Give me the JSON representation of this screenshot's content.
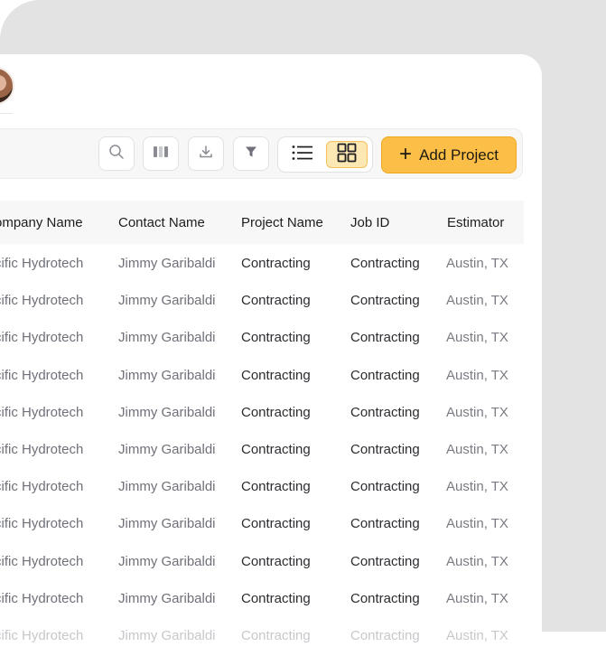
{
  "table": {
    "headers": [
      "ompany Name",
      "Contact Name",
      "Project Name",
      "Job ID",
      "Estimator"
    ],
    "rows": [
      [
        "cific Hydrotech",
        "Jimmy Garibaldi",
        "Contracting",
        "Contracting",
        "Austin, TX"
      ],
      [
        "cific Hydrotech",
        "Jimmy Garibaldi",
        "Contracting",
        "Contracting",
        "Austin, TX"
      ],
      [
        "cific Hydrotech",
        "Jimmy Garibaldi",
        "Contracting",
        "Contracting",
        "Austin, TX"
      ],
      [
        "cific Hydrotech",
        "Jimmy Garibaldi",
        "Contracting",
        "Contracting",
        "Austin, TX"
      ],
      [
        "cific Hydrotech",
        "Jimmy Garibaldi",
        "Contracting",
        "Contracting",
        "Austin, TX"
      ],
      [
        "cific Hydrotech",
        "Jimmy Garibaldi",
        "Contracting",
        "Contracting",
        "Austin, TX"
      ],
      [
        "cific Hydrotech",
        "Jimmy Garibaldi",
        "Contracting",
        "Contracting",
        "Austin, TX"
      ],
      [
        "cific Hydrotech",
        "Jimmy Garibaldi",
        "Contracting",
        "Contracting",
        "Austin, TX"
      ],
      [
        "cific Hydrotech",
        "Jimmy Garibaldi",
        "Contracting",
        "Contracting",
        "Austin, TX"
      ],
      [
        "cific Hydrotech",
        "Jimmy Garibaldi",
        "Contracting",
        "Contracting",
        "Austin, TX"
      ],
      [
        "cific Hydrotech",
        "Jimmy Garibaldi",
        "Contracting",
        "Contracting",
        "Austin, TX"
      ]
    ]
  },
  "toolbar": {
    "add_label": "Add Project",
    "icons": [
      "search-icon",
      "columns-icon",
      "download-icon",
      "filter-icon",
      "list-view-icon",
      "grid-view-icon"
    ],
    "active_view": "grid"
  },
  "colors": {
    "accent": "#fbbf47",
    "accent_border": "#f0a81f",
    "active_view_bg": "#fde7b3",
    "backdrop": "#e3e3e4"
  }
}
